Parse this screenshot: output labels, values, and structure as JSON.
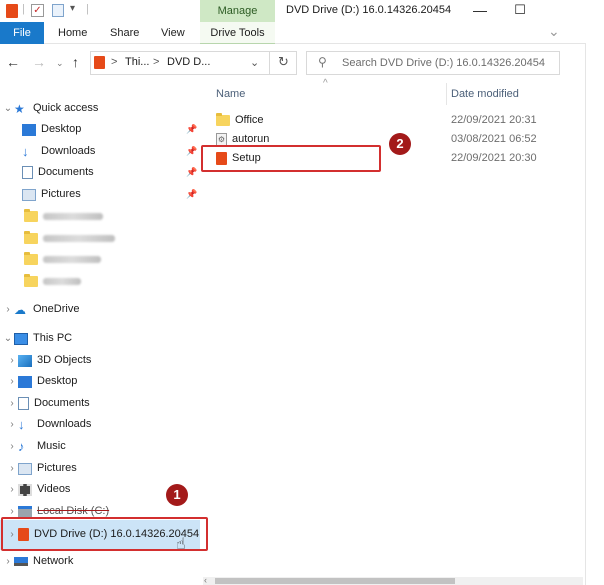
{
  "titlebar": {
    "manage_label": "Manage",
    "drive_tools_label": "Drive Tools",
    "title": "DVD Drive (D:) 16.0.14326.20454",
    "minimize": "—",
    "maximize": "☐"
  },
  "ribbon": {
    "file": "File",
    "home": "Home",
    "share": "Share",
    "view": "View",
    "expand": "⌄"
  },
  "address": {
    "crumb1": "Thi...",
    "sep": ">",
    "crumb2": "DVD D...",
    "search_placeholder": "Search DVD Drive (D:) 16.0.14326.20454"
  },
  "columns": {
    "name": "Name",
    "date": "Date modified"
  },
  "files": [
    {
      "name": "Office",
      "date": "22/09/2021 20:31",
      "icon": "folder-icon"
    },
    {
      "name": "autorun",
      "date": "03/08/2021 06:52",
      "icon": "autorun-icon"
    },
    {
      "name": "Setup",
      "date": "22/09/2021 20:30",
      "icon": "office-setup-icon"
    }
  ],
  "sidebar": {
    "quick_access": "Quick access",
    "qa_items": [
      "Desktop",
      "Downloads",
      "Documents",
      "Pictures"
    ],
    "onedrive": "OneDrive",
    "this_pc": "This PC",
    "pc_items": [
      "3D Objects",
      "Desktop",
      "Documents",
      "Downloads",
      "Music",
      "Pictures",
      "Videos",
      "Local Disk (C:)",
      "DVD Drive (D:) 16.0.14326.20454"
    ],
    "network": "Network"
  },
  "badges": [
    "1",
    "2"
  ],
  "colors": {
    "accent": "#1979ca",
    "manage_bg": "#cfe8c5",
    "highlight_box": "#d32f2f",
    "badge": "#a31a1a",
    "selection": "#cce4f7"
  }
}
